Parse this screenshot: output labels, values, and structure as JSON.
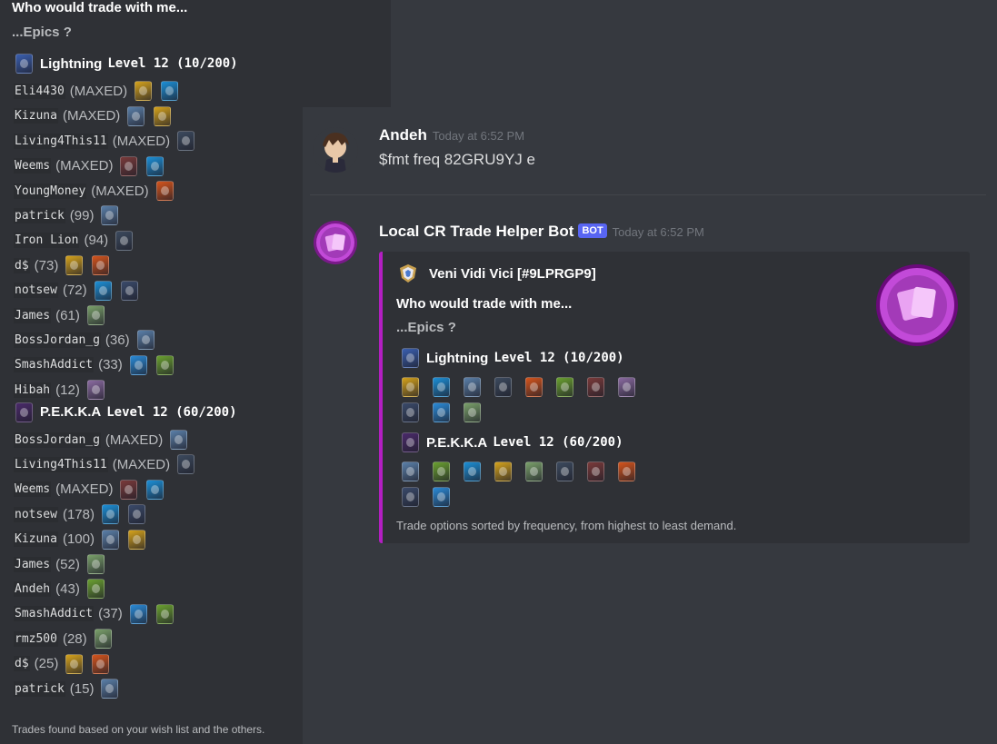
{
  "colors": {
    "background": "#36393f",
    "embed_bar": "#b31ec2",
    "bot_tag": "#5865f2"
  },
  "left_panel": {
    "title": "Who would trade with me...",
    "subtitle": "...Epics ?",
    "footer": "Trades found based on your wish list and the others.",
    "sections": [
      {
        "name": "Lightning",
        "level": "Level 12 (10/200)",
        "icon": "lightning-card-icon",
        "icon_color": "#3a5fb0",
        "players": [
          {
            "name": "Eli4430",
            "count": "(MAXED)",
            "cards": [
              "#d4a21c",
              "#1c8fd6"
            ]
          },
          {
            "name": "Kizuna",
            "count": "(MAXED)",
            "cards": [
              "#5a7fa8",
              "#d4a21c"
            ]
          },
          {
            "name": "Living4This11",
            "count": "(MAXED)",
            "cards": [
              "#3c4a5e"
            ]
          },
          {
            "name": "Weems",
            "count": "(MAXED)",
            "cards": [
              "#7a3a3a",
              "#1c8fd6"
            ]
          },
          {
            "name": "YoungMoney",
            "count": "(MAXED)",
            "cards": [
              "#d4541c"
            ]
          },
          {
            "name": "patrick",
            "count": "(99)",
            "cards": [
              "#5a7fa8"
            ]
          },
          {
            "name": "Iron Lion",
            "count": "(94)",
            "cards": [
              "#3c4a5e"
            ]
          },
          {
            "name": "d$",
            "count": "(73)",
            "cards": [
              "#d4a21c",
              "#d4541c"
            ]
          },
          {
            "name": "notsew",
            "count": "(72)",
            "cards": [
              "#1c8fd6",
              "#3a4a6a"
            ]
          },
          {
            "name": "James",
            "count": "(61)",
            "cards": [
              "#7aa06a"
            ]
          },
          {
            "name": "BossJordan_g",
            "count": "(36)",
            "cards": [
              "#5a7fa8"
            ]
          },
          {
            "name": "SmashAddict",
            "count": "(33)",
            "cards": [
              "#2a8ad6",
              "#6aa030"
            ]
          },
          {
            "name": "Hibah",
            "count": "(12)",
            "cards": [
              "#8a6aa0"
            ]
          }
        ]
      },
      {
        "name": "P.E.K.K.A",
        "level": "Level 12 (60/200)",
        "icon": "pekka-card-icon",
        "icon_color": "#4a2a6a",
        "players": [
          {
            "name": "BossJordan_g",
            "count": "(MAXED)",
            "cards": [
              "#5a7fa8"
            ]
          },
          {
            "name": "Living4This11",
            "count": "(MAXED)",
            "cards": [
              "#3c4a5e"
            ]
          },
          {
            "name": "Weems",
            "count": "(MAXED)",
            "cards": [
              "#7a3a3a",
              "#1c8fd6"
            ]
          },
          {
            "name": "notsew",
            "count": "(178)",
            "cards": [
              "#1c8fd6",
              "#3a4a6a"
            ]
          },
          {
            "name": "Kizuna",
            "count": "(100)",
            "cards": [
              "#5a7fa8",
              "#d4a21c"
            ]
          },
          {
            "name": "James",
            "count": "(52)",
            "cards": [
              "#7aa06a"
            ]
          },
          {
            "name": "Andeh",
            "count": "(43)",
            "cards": [
              "#6aa030"
            ]
          },
          {
            "name": "SmashAddict",
            "count": "(37)",
            "cards": [
              "#2a8ad6",
              "#6aa030"
            ]
          },
          {
            "name": "rmz500",
            "count": "(28)",
            "cards": [
              "#7aa06a"
            ]
          },
          {
            "name": "d$",
            "count": "(25)",
            "cards": [
              "#d4a21c",
              "#d4541c"
            ]
          },
          {
            "name": "patrick",
            "count": "(15)",
            "cards": [
              "#5a7fa8"
            ]
          }
        ]
      }
    ]
  },
  "messages": {
    "user": {
      "author": "Andeh",
      "timestamp": "Today at 6:52 PM",
      "content": "$fmt freq 82GRU9YJ e"
    },
    "bot": {
      "author": "Local CR Trade Helper Bot",
      "tag": "BOT",
      "timestamp": "Today at 6:52 PM",
      "embed": {
        "author": "Veni Vidi Vici [#9LPRGP9]",
        "title": "Who would trade with me...",
        "subtitle": "...Epics ?",
        "footer": "Trade options sorted by frequency, from highest to least demand.",
        "sections": [
          {
            "name": "Lightning",
            "level": "Level 12 (10/200)",
            "icon_color": "#3a5fb0",
            "rows": [
              [
                "#d4a21c",
                "#1c8fd6",
                "#5a7fa8",
                "#3c4a5e",
                "#d4541c",
                "#6aa030",
                "#7a3a3a",
                "#8a6aa0"
              ],
              [
                "#3a4a6a",
                "#2a8ad6",
                "#7aa06a"
              ]
            ]
          },
          {
            "name": "P.E.K.K.A",
            "level": "Level 12 (60/200)",
            "icon_color": "#4a2a6a",
            "rows": [
              [
                "#5a7fa8",
                "#6aa030",
                "#1c8fd6",
                "#d4a21c",
                "#7aa06a",
                "#3c4a5e",
                "#7a3a3a",
                "#d4541c"
              ],
              [
                "#3a4a6a",
                "#2a8ad6"
              ]
            ]
          }
        ]
      }
    }
  }
}
